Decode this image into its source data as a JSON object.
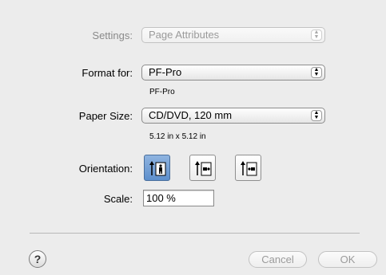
{
  "settings": {
    "label": "Settings:",
    "value": "Page Attributes"
  },
  "format_for": {
    "label": "Format for:",
    "value": "PF-Pro",
    "sub": "PF-Pro"
  },
  "paper_size": {
    "label": "Paper Size:",
    "value": "CD/DVD, 120 mm",
    "sub": "5.12 in x 5.12 in"
  },
  "orientation": {
    "label": "Orientation:",
    "options": [
      {
        "name": "portrait",
        "selected": true
      },
      {
        "name": "landscape-left",
        "selected": false
      },
      {
        "name": "landscape-right",
        "selected": false
      }
    ]
  },
  "scale": {
    "label": "Scale:",
    "value": "100 %"
  },
  "buttons": {
    "help": "?",
    "cancel": "Cancel",
    "ok": "OK"
  },
  "colors": {
    "background": "#ececec",
    "selected_orientation": "#6e9ad3"
  }
}
